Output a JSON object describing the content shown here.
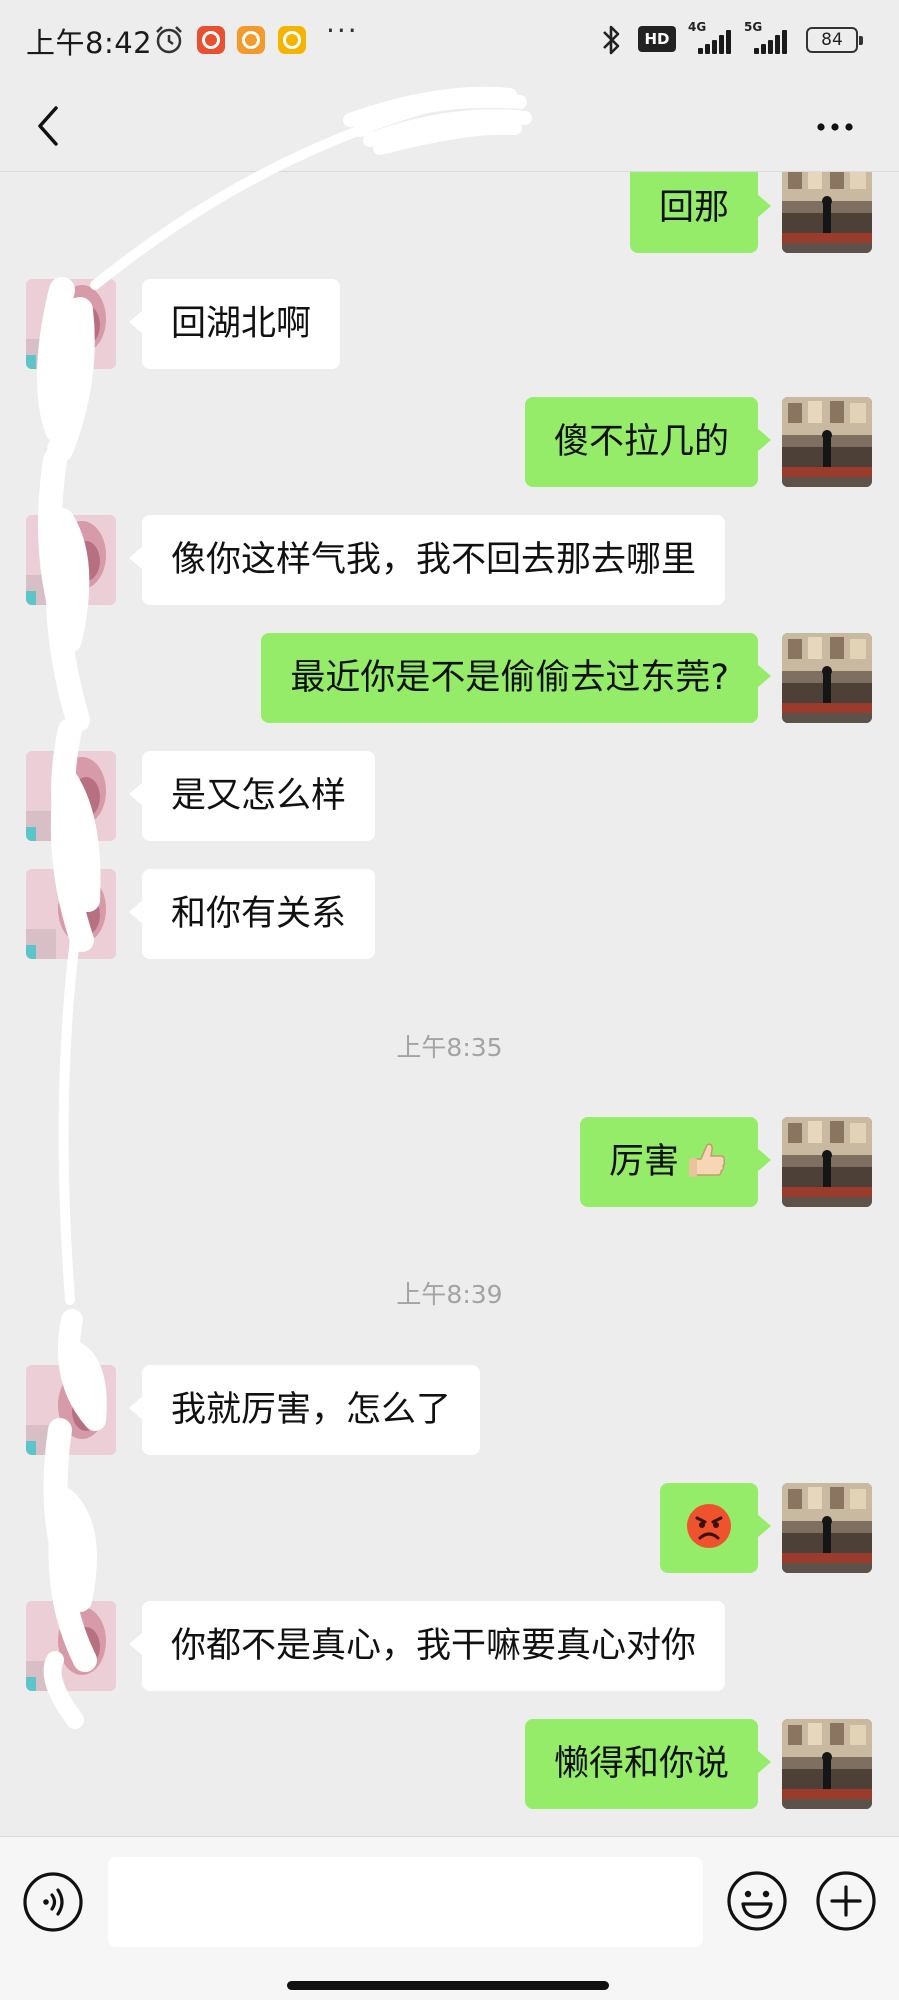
{
  "status_bar": {
    "time": "上午8:42",
    "dots": "···",
    "hd_label": "HD",
    "network_1": "4G",
    "network_2": "5G",
    "battery": "84"
  },
  "nav": {
    "title": ""
  },
  "colors": {
    "background": "#ededed",
    "my_bubble": "#95ec69",
    "their_bubble": "#ffffff",
    "timestamp_text": "#a3a3a3"
  },
  "messages": [
    {
      "side": "me",
      "text": "回那"
    },
    {
      "side": "other",
      "text": "回湖北啊"
    },
    {
      "side": "me",
      "text": "傻不拉几的"
    },
    {
      "side": "other",
      "text": "像你这样气我，我不回去那去哪里"
    },
    {
      "side": "me",
      "text": "最近你是不是偷偷去过东莞?"
    },
    {
      "side": "other",
      "text": "是又怎么样"
    },
    {
      "side": "other",
      "text": "和你有关系"
    },
    {
      "side": "time",
      "text": "上午8:35"
    },
    {
      "side": "me",
      "text": "厉害",
      "emoji": "thumbs-up-emoji"
    },
    {
      "side": "time",
      "text": "上午8:39"
    },
    {
      "side": "other",
      "text": "我就厉害，怎么了"
    },
    {
      "side": "me",
      "text": "",
      "emoji": "angry-face-emoji"
    },
    {
      "side": "other",
      "text": "你都不是真心，我干嘛要真心对你"
    },
    {
      "side": "me",
      "text": "懒得和你说"
    }
  ],
  "input_bar": {
    "value": "",
    "icons": [
      "voice-icon",
      "emoji-icon",
      "plus-icon"
    ]
  }
}
